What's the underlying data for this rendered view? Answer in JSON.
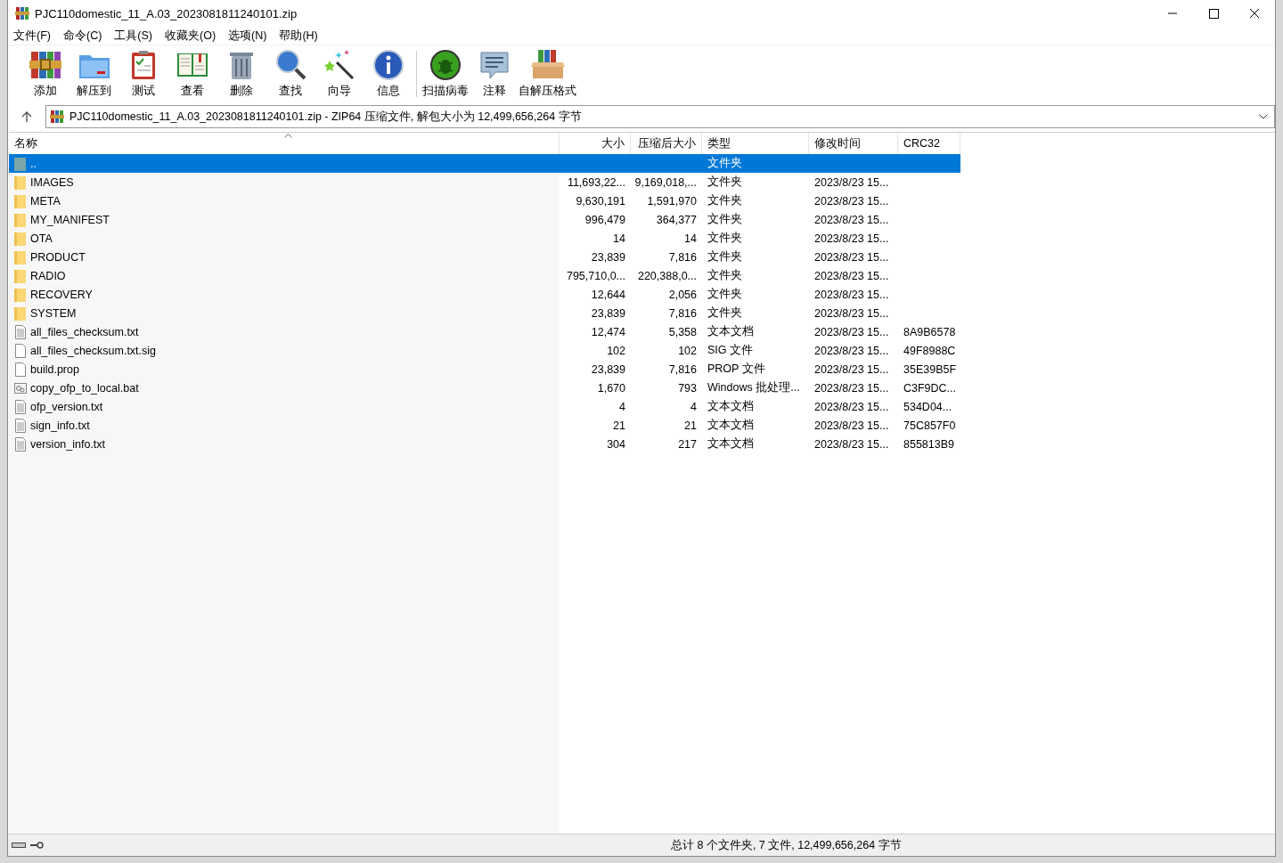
{
  "window": {
    "title": "PJC110domestic_11_A.03_2023081811240101.zip"
  },
  "menu": [
    "文件(F)",
    "命令(C)",
    "工具(S)",
    "收藏夹(O)",
    "选项(N)",
    "帮助(H)"
  ],
  "toolbar": [
    [
      {
        "label": "添加",
        "kind": "add"
      },
      {
        "label": "解压到",
        "kind": "extract"
      },
      {
        "label": "测试",
        "kind": "test"
      },
      {
        "label": "查看",
        "kind": "view"
      },
      {
        "label": "删除",
        "kind": "delete"
      },
      {
        "label": "查找",
        "kind": "find"
      },
      {
        "label": "向导",
        "kind": "wizard"
      },
      {
        "label": "信息",
        "kind": "info"
      }
    ],
    [
      {
        "label": "扫描病毒",
        "kind": "scan"
      },
      {
        "label": "注释",
        "kind": "comment"
      },
      {
        "label": "自解压格式",
        "kind": "sfx"
      }
    ]
  ],
  "address": "PJC110domestic_11_A.03_2023081811240101.zip - ZIP64 压缩文件, 解包大小为 12,499,656,264 字节",
  "columns": [
    {
      "label": "名称",
      "sorted": true
    },
    {
      "label": "大小",
      "sorted": false
    },
    {
      "label": "压缩后大小",
      "sorted": false
    },
    {
      "label": "类型",
      "sorted": false
    },
    {
      "label": "修改时间",
      "sorted": false
    },
    {
      "label": "CRC32",
      "sorted": false
    }
  ],
  "rows": [
    {
      "name": "..",
      "kind": "parent",
      "selected": true,
      "size": "",
      "packed": "",
      "type": "文件夹",
      "modified": "",
      "crc": ""
    },
    {
      "name": "IMAGES",
      "kind": "folder",
      "selected": false,
      "size": "11,693,22...",
      "packed": "9,169,018,...",
      "type": "文件夹",
      "modified": "2023/8/23 15...",
      "crc": ""
    },
    {
      "name": "META",
      "kind": "folder",
      "selected": false,
      "size": "9,630,191",
      "packed": "1,591,970",
      "type": "文件夹",
      "modified": "2023/8/23 15...",
      "crc": ""
    },
    {
      "name": "MY_MANIFEST",
      "kind": "folder",
      "selected": false,
      "size": "996,479",
      "packed": "364,377",
      "type": "文件夹",
      "modified": "2023/8/23 15...",
      "crc": ""
    },
    {
      "name": "OTA",
      "kind": "folder",
      "selected": false,
      "size": "14",
      "packed": "14",
      "type": "文件夹",
      "modified": "2023/8/23 15...",
      "crc": ""
    },
    {
      "name": "PRODUCT",
      "kind": "folder",
      "selected": false,
      "size": "23,839",
      "packed": "7,816",
      "type": "文件夹",
      "modified": "2023/8/23 15...",
      "crc": ""
    },
    {
      "name": "RADIO",
      "kind": "folder",
      "selected": false,
      "size": "795,710,0...",
      "packed": "220,388,0...",
      "type": "文件夹",
      "modified": "2023/8/23 15...",
      "crc": ""
    },
    {
      "name": "RECOVERY",
      "kind": "folder",
      "selected": false,
      "size": "12,644",
      "packed": "2,056",
      "type": "文件夹",
      "modified": "2023/8/23 15...",
      "crc": ""
    },
    {
      "name": "SYSTEM",
      "kind": "folder",
      "selected": false,
      "size": "23,839",
      "packed": "7,816",
      "type": "文件夹",
      "modified": "2023/8/23 15...",
      "crc": ""
    },
    {
      "name": "all_files_checksum.txt",
      "kind": "text",
      "selected": false,
      "size": "12,474",
      "packed": "5,358",
      "type": "文本文档",
      "modified": "2023/8/23 15...",
      "crc": "8A9B6578"
    },
    {
      "name": "all_files_checksum.txt.sig",
      "kind": "blank",
      "selected": false,
      "size": "102",
      "packed": "102",
      "type": "SIG 文件",
      "modified": "2023/8/23 15...",
      "crc": "49F8988C"
    },
    {
      "name": "build.prop",
      "kind": "blank",
      "selected": false,
      "size": "23,839",
      "packed": "7,816",
      "type": "PROP 文件",
      "modified": "2023/8/23 15...",
      "crc": "35E39B5F"
    },
    {
      "name": "copy_ofp_to_local.bat",
      "kind": "batch",
      "selected": false,
      "size": "1,670",
      "packed": "793",
      "type": "Windows 批处理...",
      "modified": "2023/8/23 15...",
      "crc": "C3F9DC..."
    },
    {
      "name": "ofp_version.txt",
      "kind": "text",
      "selected": false,
      "size": "4",
      "packed": "4",
      "type": "文本文档",
      "modified": "2023/8/23 15...",
      "crc": "534D04..."
    },
    {
      "name": "sign_info.txt",
      "kind": "text",
      "selected": false,
      "size": "21",
      "packed": "21",
      "type": "文本文档",
      "modified": "2023/8/23 15...",
      "crc": "75C857F0"
    },
    {
      "name": "version_info.txt",
      "kind": "text",
      "selected": false,
      "size": "304",
      "packed": "217",
      "type": "文本文档",
      "modified": "2023/8/23 15...",
      "crc": "855813B9"
    }
  ],
  "status_bar": "总计 8 个文件夹, 7 文件, 12,499,656,264 字节"
}
